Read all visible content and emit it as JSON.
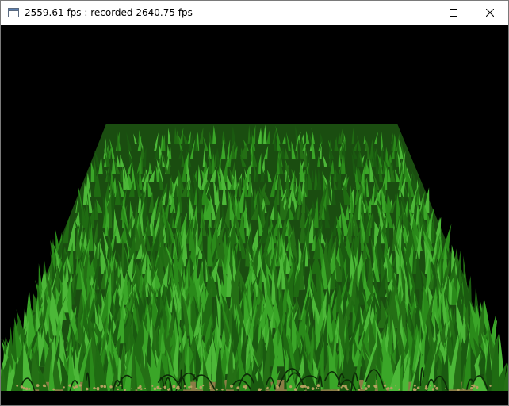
{
  "window": {
    "title": "2559.61 fps : recorded 2640.75 fps",
    "controls": {
      "minimize": "minimize-icon",
      "maximize": "maximize-icon",
      "close": "close-icon"
    }
  },
  "scene": {
    "background": "#000000",
    "grass_colors": [
      "#1f6b12",
      "#2a8a1a",
      "#3aa628",
      "#1a5a10",
      "#4cb838",
      "#246f15"
    ],
    "soil_color": "#b5a060"
  }
}
